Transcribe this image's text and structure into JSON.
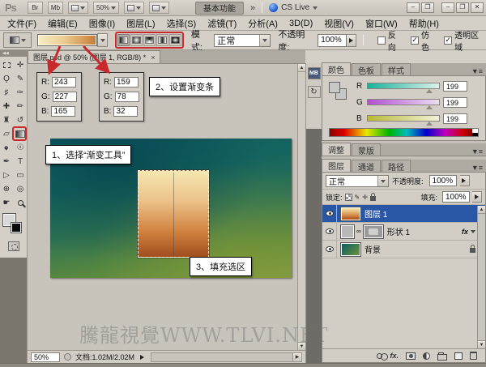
{
  "titlebar": {
    "logo": "Ps",
    "bridge": "Br",
    "mini_bridge": "Mb",
    "zoom_level": "50%",
    "workspace": "基本功能",
    "more": "»",
    "cs_live": "CS Live",
    "window_buttons": [
      "–",
      "❐",
      "–",
      "❐",
      "✕"
    ]
  },
  "menubar": {
    "items": [
      "文件(F)",
      "编辑(E)",
      "图像(I)",
      "图层(L)",
      "选择(S)",
      "滤镜(T)",
      "分析(A)",
      "3D(D)",
      "视图(V)",
      "窗口(W)",
      "帮助(H)"
    ]
  },
  "options_bar": {
    "mode_label": "模式:",
    "mode_value": "正常",
    "opacity_label": "不透明度:",
    "opacity_value": "100%",
    "check_reverse": "反向",
    "check_dither": "仿色",
    "check_transparency": "透明区域"
  },
  "toolbar": {
    "collapse": "◀◀",
    "tools": [
      {
        "name": "rectangular-marquee",
        "glyph": ""
      },
      {
        "name": "move",
        "glyph": "✛"
      },
      {
        "name": "lasso",
        "glyph": "Ϙ"
      },
      {
        "name": "quick-selection",
        "glyph": "✎"
      },
      {
        "name": "crop",
        "glyph": "♯"
      },
      {
        "name": "eyedropper",
        "glyph": "✑"
      },
      {
        "name": "spot-healing-brush",
        "glyph": "✚"
      },
      {
        "name": "brush",
        "glyph": "✏"
      },
      {
        "name": "clone-stamp",
        "glyph": "♜"
      },
      {
        "name": "history-brush",
        "glyph": "↺"
      },
      {
        "name": "eraser",
        "glyph": "▱"
      },
      {
        "name": "gradient",
        "glyph": ""
      },
      {
        "name": "blur",
        "glyph": "♠"
      },
      {
        "name": "dodge",
        "glyph": "☉"
      },
      {
        "name": "pen",
        "glyph": "✒"
      },
      {
        "name": "type",
        "glyph": "T"
      },
      {
        "name": "path-selection",
        "glyph": "▷"
      },
      {
        "name": "rectangle-shape",
        "glyph": "▭"
      },
      {
        "name": "3d-rotate",
        "glyph": "⊕"
      },
      {
        "name": "3d-camera",
        "glyph": "◎"
      },
      {
        "name": "hand",
        "glyph": "☛"
      },
      {
        "name": "zoom",
        "glyph": ""
      }
    ]
  },
  "document": {
    "tab_title": "图层.psd @ 50% (图层 1, RGB/8) *",
    "tab_close": "×",
    "status_zoom": "50%",
    "status_doc": "文档:1.02M/2.02M"
  },
  "annotations": {
    "step1": "1、选择“渐变工具”",
    "step2": "2、设置渐变条",
    "step3": "3、填充选区",
    "r_label": "R:",
    "g_label": "G:",
    "b_label": "B:",
    "box1": {
      "r": "243",
      "g": "227",
      "b": "165"
    },
    "box2": {
      "r": "159",
      "g": "78",
      "b": "32"
    }
  },
  "color_panel": {
    "tab_color": "颜色",
    "tab_swatches": "色板",
    "tab_styles": "样式",
    "r": "R",
    "g": "G",
    "b": "B",
    "r_value": "199",
    "g_value": "199",
    "b_value": "199"
  },
  "adjust_panel": {
    "tab_adjust": "调整",
    "tab_mask": "蒙版"
  },
  "layers_panel": {
    "tab_layers": "图层",
    "tab_channels": "通道",
    "tab_paths": "路径",
    "blend_mode": "正常",
    "opacity_label": "不透明度:",
    "opacity_value": "100%",
    "lock_label": "锁定:",
    "fill_label": "填充:",
    "fill_value": "100%",
    "layer1_name": "图层 1",
    "layer2_name": "形状 1",
    "layer2_fx": "fx",
    "layer3_name": "背景",
    "fx_button": "fx."
  },
  "icons": {
    "panel_menu": "▼≡",
    "mini_bridge_panel": "MB",
    "history_panel": "↻",
    "scroll_up": "▲",
    "scroll_down": "▼",
    "scroll_right": "▶",
    "link_glyph": "∞"
  },
  "watermark": "騰龍視覺WWW.TLVI.NET",
  "colors": {
    "accent_red": "#c9282d",
    "selected_layer_blue": "#2a57a5",
    "gradient_light": "#f3e3a5",
    "gradient_dark": "#9f4e20",
    "canvas_teal": "#0d5a64",
    "canvas_green": "#7d9a45"
  }
}
